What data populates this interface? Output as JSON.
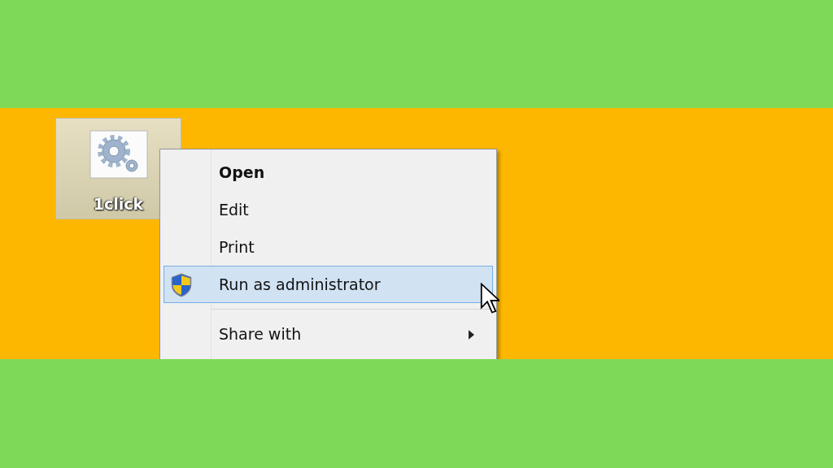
{
  "desktop": {
    "icons": [
      {
        "label": "1click",
        "selected": true
      }
    ]
  },
  "context_menu": {
    "items": [
      {
        "kind": "action",
        "label": "Open",
        "default": true,
        "selected": false
      },
      {
        "kind": "action",
        "label": "Edit",
        "default": false,
        "selected": false
      },
      {
        "kind": "action",
        "label": "Print",
        "default": false,
        "selected": false
      },
      {
        "kind": "action",
        "label": "Run as administrator",
        "default": false,
        "selected": true,
        "shield": true
      },
      {
        "kind": "separator"
      },
      {
        "kind": "submenu",
        "label": "Share with",
        "default": false,
        "selected": false
      }
    ]
  }
}
